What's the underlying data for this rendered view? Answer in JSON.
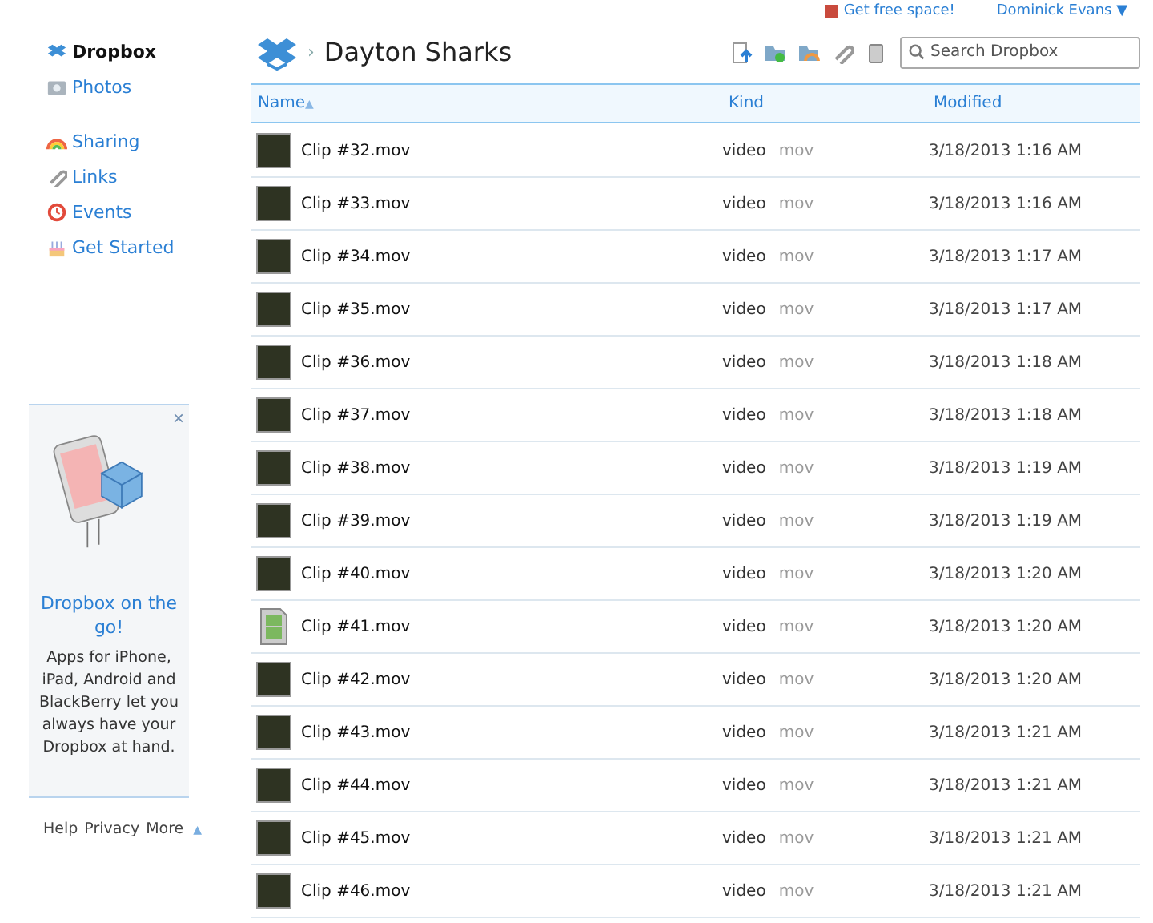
{
  "top_bar": {
    "free_space_link": "Get free space!",
    "account_menu": "Dominick Evans",
    "account_caret": "▼"
  },
  "sidebar": {
    "groups": [
      [
        {
          "label": "Dropbox",
          "selected": true
        },
        {
          "label": "Photos",
          "selected": false
        }
      ],
      [
        {
          "label": "Sharing",
          "selected": false
        },
        {
          "label": "Links",
          "selected": false
        },
        {
          "label": "Events",
          "selected": false
        },
        {
          "label": "Get Started",
          "selected": false
        }
      ]
    ],
    "promo": {
      "close": "×",
      "title": "Dropbox on the go!",
      "text": "Apps for iPhone, iPad, Android and BlackBerry let you always have your Dropbox at hand."
    },
    "footer": [
      "Help",
      "Privacy",
      "More"
    ],
    "footer_caret": "▲"
  },
  "breadcrumb": {
    "separator": "›",
    "folder": "Dayton Sharks"
  },
  "search": {
    "placeholder": "Search Dropbox"
  },
  "table": {
    "columns": [
      {
        "label": "Name",
        "sort": "▲"
      },
      {
        "label": "Kind"
      },
      {
        "label": "Modified"
      }
    ],
    "rows": [
      {
        "kind": "thumbnail",
        "name": "Clip #32.mov",
        "type": "video",
        "ext": "mov",
        "modified": "3/18/2013 1:16 AM"
      },
      {
        "kind": "thumbnail",
        "name": "Clip #33.mov",
        "type": "video",
        "ext": "mov",
        "modified": "3/18/2013 1:16 AM"
      },
      {
        "kind": "thumbnail",
        "name": "Clip #34.mov",
        "type": "video",
        "ext": "mov",
        "modified": "3/18/2013 1:17 AM"
      },
      {
        "kind": "thumbnail",
        "name": "Clip #35.mov",
        "type": "video",
        "ext": "mov",
        "modified": "3/18/2013 1:17 AM"
      },
      {
        "kind": "thumbnail",
        "name": "Clip #36.mov",
        "type": "video",
        "ext": "mov",
        "modified": "3/18/2013 1:18 AM"
      },
      {
        "kind": "thumbnail",
        "name": "Clip #37.mov",
        "type": "video",
        "ext": "mov",
        "modified": "3/18/2013 1:18 AM"
      },
      {
        "kind": "thumbnail",
        "name": "Clip #38.mov",
        "type": "video",
        "ext": "mov",
        "modified": "3/18/2013 1:19 AM"
      },
      {
        "kind": "thumbnail",
        "name": "Clip #39.mov",
        "type": "video",
        "ext": "mov",
        "modified": "3/18/2013 1:19 AM"
      },
      {
        "kind": "thumbnail",
        "name": "Clip #40.mov",
        "type": "video",
        "ext": "mov",
        "modified": "3/18/2013 1:20 AM"
      },
      {
        "kind": "icon",
        "name": "Clip #41.mov",
        "type": "video",
        "ext": "mov",
        "modified": "3/18/2013 1:20 AM"
      },
      {
        "kind": "thumbnail",
        "name": "Clip #42.mov",
        "type": "video",
        "ext": "mov",
        "modified": "3/18/2013 1:20 AM"
      },
      {
        "kind": "thumbnail",
        "name": "Clip #43.mov",
        "type": "video",
        "ext": "mov",
        "modified": "3/18/2013 1:21 AM"
      },
      {
        "kind": "thumbnail",
        "name": "Clip #44.mov",
        "type": "video",
        "ext": "mov",
        "modified": "3/18/2013 1:21 AM"
      },
      {
        "kind": "thumbnail",
        "name": "Clip #45.mov",
        "type": "video",
        "ext": "mov",
        "modified": "3/18/2013 1:21 AM"
      },
      {
        "kind": "thumbnail",
        "name": "Clip #46.mov",
        "type": "video",
        "ext": "mov",
        "modified": "3/18/2013 1:21 AM"
      }
    ]
  }
}
